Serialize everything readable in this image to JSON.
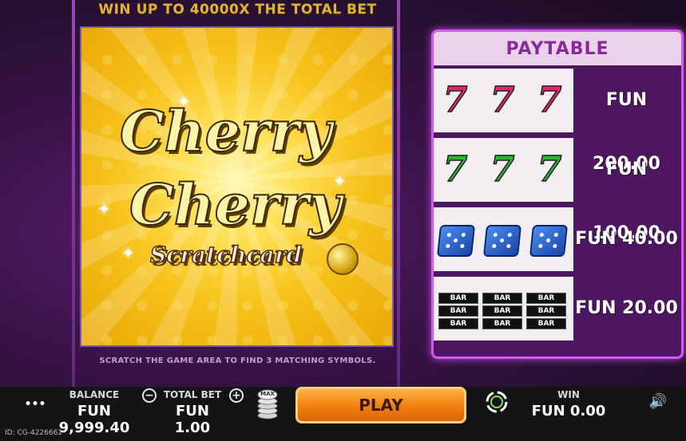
{
  "headline": "WIN UP TO 40000X THE TOTAL BET",
  "logo": {
    "line1": "Cherry",
    "line2": "Cherry",
    "line3": "Scratchcard"
  },
  "instructions": "SCRATCH THE GAME AREA TO FIND 3 MATCHING SYMBOLS.",
  "paytable": {
    "title": "PAYTABLE",
    "rows": [
      {
        "symbol": "red-seven",
        "value": "FUN 200.00"
      },
      {
        "symbol": "green-seven",
        "value": "FUN 100.00"
      },
      {
        "symbol": "blue-dice",
        "value": "FUN 40.00"
      },
      {
        "symbol": "bar",
        "value": "FUN 20.00"
      }
    ],
    "seven_glyph": "7",
    "bar_text": "BAR"
  },
  "bottom": {
    "menu_glyph": "•••",
    "balance_label": "BALANCE",
    "balance_value": "FUN 9,999.40",
    "minus_glyph": "−",
    "plus_glyph": "+",
    "total_bet_label": "TOTAL BET",
    "total_bet_value": "FUN 1.00",
    "max_label": "MAX",
    "play_label": "PLAY",
    "win_label": "WIN",
    "win_value": "FUN 0.00",
    "sound_glyph": "🔊"
  },
  "game_id": "ID: CG-4226662",
  "colors": {
    "accent": "#d15af0",
    "gold": "#e0b233",
    "play": "#f07f0b"
  }
}
